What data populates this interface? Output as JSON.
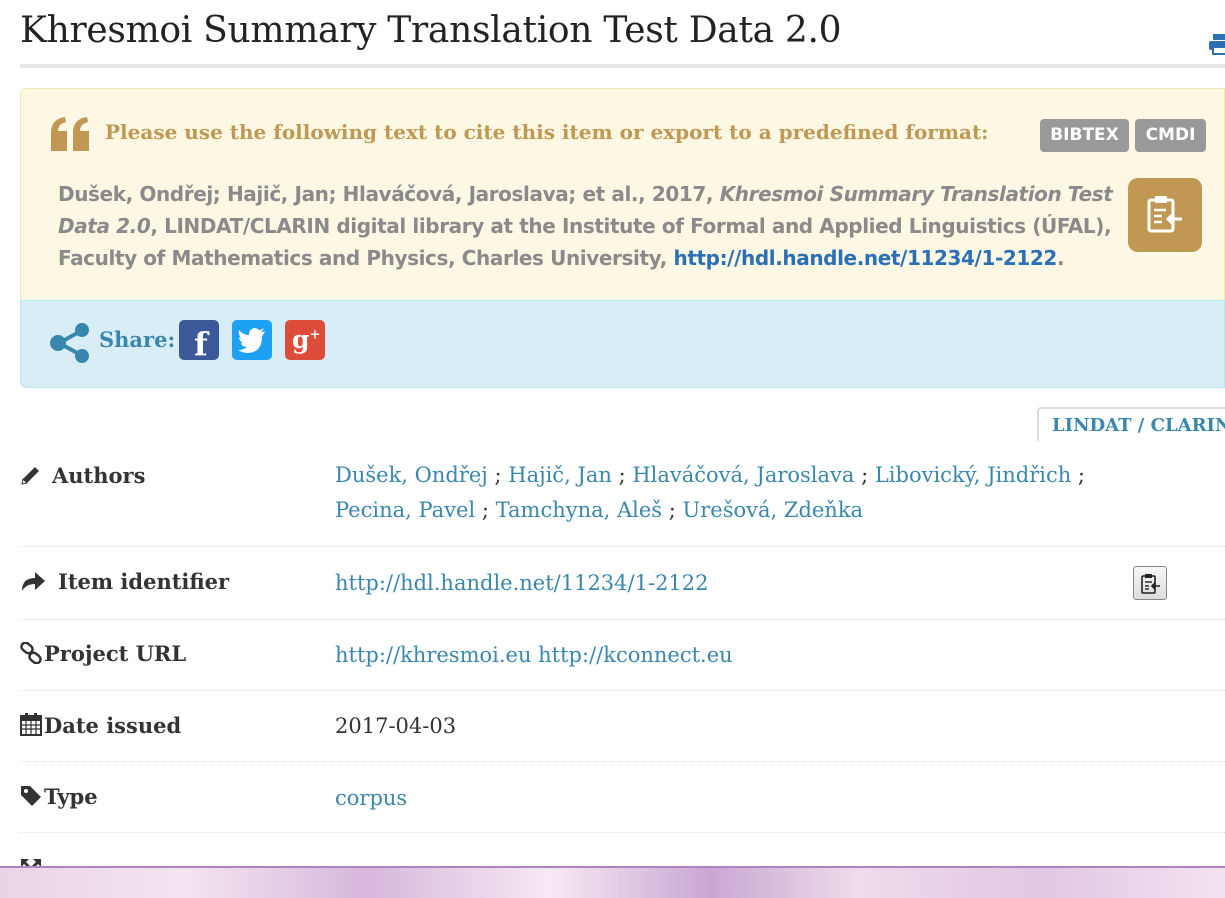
{
  "page": {
    "title": "Khresmoi Summary Translation Test Data 2.0"
  },
  "citation": {
    "heading": "Please use the following text to cite this item or export to a predefined format:",
    "export_buttons": [
      "BIBTEX",
      "CMDI"
    ],
    "authors_text": "Dušek, Ondřej; Hajič, Jan; Hlaváčová, Jaroslava; et al., 2017, ",
    "title_text": "Khresmoi Summary Translation Test Data 2.0",
    "publisher_text": ", LINDAT/CLARIN digital library at the Institute of Formal and Applied Linguistics (ÚFAL), Faculty of Mathematics and Physics, Charles University, ",
    "link": "http://hdl.handle.net/11234/1-2122",
    "end": "."
  },
  "share": {
    "label": "Share:"
  },
  "tab": {
    "label": "LINDAT / CLARIN"
  },
  "metadata": {
    "authors_label": "Authors",
    "authors": [
      "Dušek, Ondřej",
      "Hajič, Jan",
      "Hlaváčová, Jaroslava",
      "Libovický, Jindřich",
      "Pecina, Pavel",
      "Tamchyna, Aleš",
      "Urešová, Zdeňka"
    ],
    "author_separator": " ; ",
    "identifier_label": "Item identifier",
    "identifier": "http://hdl.handle.net/11234/1-2122",
    "project_url_label": "Project URL",
    "project_urls": [
      "http://khresmoi.eu",
      "http://kconnect.eu"
    ],
    "date_label": "Date issued",
    "date": "2017-04-03",
    "type_label": "Type",
    "type": "corpus"
  },
  "colors": {
    "cite_bg": "#fcf8e3",
    "cite_accent": "#c09853",
    "share_bg": "#d9edf7",
    "link": "#3a87ad",
    "facebook": "#3b5998",
    "twitter": "#1da1f2",
    "googleplus": "#dd4b39"
  }
}
